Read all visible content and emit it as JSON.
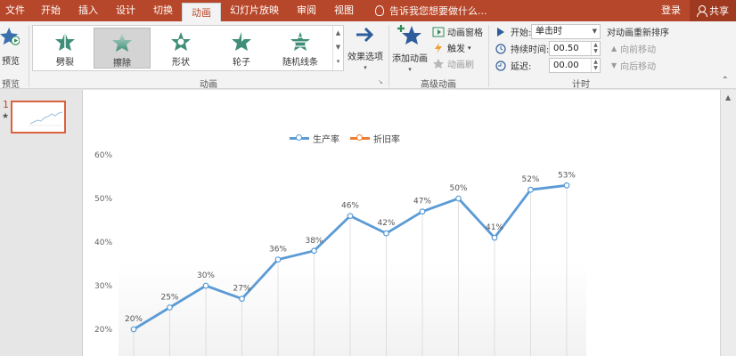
{
  "tabs": [
    "文件",
    "开始",
    "插入",
    "设计",
    "切换",
    "动画",
    "幻灯片放映",
    "审阅",
    "视图"
  ],
  "active_tab": "动画",
  "tell_me": "告诉我您想要做什么...",
  "login": "登录",
  "share": "共享",
  "preview_group": {
    "button": "预览",
    "label": "预览"
  },
  "animation_group": {
    "label": "动画",
    "items": [
      "劈裂",
      "擦除",
      "形状",
      "轮子",
      "随机线条"
    ],
    "selected": "擦除",
    "effect_options": "效果选项"
  },
  "advanced_group": {
    "label": "高级动画",
    "add_animation": "添加动画",
    "animation_pane": "动画窗格",
    "trigger": "触发",
    "animation_painter": "动画刷"
  },
  "timing_group": {
    "label": "计时",
    "start_label": "开始:",
    "start_value": "单击时",
    "duration_label": "持续时间:",
    "duration_value": "00.50",
    "delay_label": "延迟:",
    "delay_value": "00.00"
  },
  "reorder_group": {
    "title": "对动画重新排序",
    "move_earlier": "向前移动",
    "move_later": "向后移动"
  },
  "slide_pane": {
    "number": "1",
    "star": "★"
  },
  "colors": {
    "accent": "#b7472a",
    "series1": "#5b9bd5",
    "series2": "#ed7d31"
  },
  "chart_data": {
    "type": "line",
    "legend_position": "top",
    "series": [
      {
        "name": "生产率",
        "values": [
          0.2,
          0.25,
          0.3,
          0.27,
          0.36,
          0.38,
          0.46,
          0.42,
          0.47,
          0.5,
          0.41,
          0.52,
          0.53
        ]
      },
      {
        "name": "折旧率",
        "values": []
      }
    ],
    "data_labels": [
      "20%",
      "25%",
      "30%",
      "27%",
      "36%",
      "38%",
      "46%",
      "42%",
      "47%",
      "50%",
      "41%",
      "52%",
      "53%"
    ],
    "y_ticks": [
      "20%",
      "30%",
      "40%",
      "50%",
      "60%"
    ],
    "ylim": [
      0.2,
      0.6
    ],
    "grid": "vertical drop lines"
  }
}
